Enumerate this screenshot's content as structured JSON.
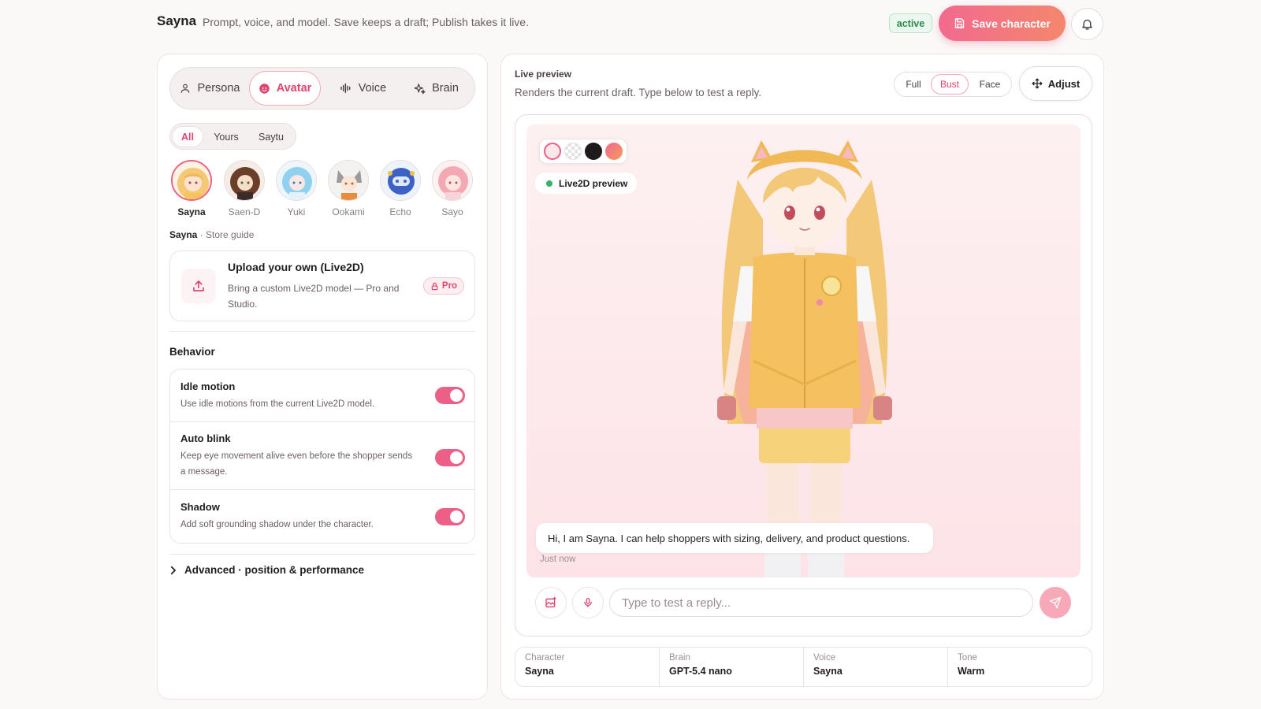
{
  "header": {
    "title": "Sayna",
    "subtitle": "Prompt, voice, and model. Save keeps a draft; Publish takes it live.",
    "status_badge": "active",
    "save_label": "Save character"
  },
  "tabs": [
    {
      "label": "Persona",
      "icon": "person-icon"
    },
    {
      "label": "Avatar",
      "icon": "avatar-icon",
      "active": true
    },
    {
      "label": "Voice",
      "icon": "waveform-icon"
    },
    {
      "label": "Brain",
      "icon": "sparkle-icon"
    }
  ],
  "filters": [
    "All",
    "Yours",
    "Saytu"
  ],
  "avatars": [
    {
      "name": "Sayna",
      "selected": true
    },
    {
      "name": "Saen-D"
    },
    {
      "name": "Yuki"
    },
    {
      "name": "Ookami"
    },
    {
      "name": "Echo"
    },
    {
      "name": "Sayo"
    }
  ],
  "store_guide": {
    "name": "Sayna",
    "suffix": " · Store guide"
  },
  "upload": {
    "title": "Upload your own (Live2D)",
    "description": "Bring a custom Live2D model — Pro and Studio.",
    "badge": "Pro"
  },
  "behavior": {
    "label": "Behavior",
    "rows": [
      {
        "title": "Idle motion",
        "description": "Use idle motions from the current Live2D model.",
        "enabled": true
      },
      {
        "title": "Auto blink",
        "description": "Keep eye movement alive even before the shopper sends a message.",
        "enabled": true
      },
      {
        "title": "Shadow",
        "description": "Add soft grounding shadow under the character.",
        "enabled": true
      }
    ]
  },
  "advanced_label": "Advanced · position & performance",
  "preview": {
    "label": "Live preview",
    "description": "Renders the current draft. Type below to test a reply.",
    "views": [
      "Full",
      "Bust",
      "Face"
    ],
    "active_view": "Bust",
    "adjust_label": "Adjust",
    "chip_label": "Live2D preview",
    "swatch_colors": [
      "#fbe6ea",
      "#e8e8e8",
      "#1f1a1b",
      "#f27f63"
    ],
    "bubble_text": "Hi, I am Sayna. I can help shoppers with sizing, delivery, and product questions.",
    "bubble_time": "Just now",
    "input_placeholder": "Type to test a reply..."
  },
  "summary": [
    {
      "label": "Character",
      "value": "Sayna"
    },
    {
      "label": "Brain",
      "value": "GPT-5.4 nano"
    },
    {
      "label": "Voice",
      "value": "Sayna"
    },
    {
      "label": "Tone",
      "value": "Warm"
    }
  ],
  "colors": {
    "accent": "#ec5f86",
    "accent_text": "#e0456e",
    "live": "#2fb566"
  }
}
